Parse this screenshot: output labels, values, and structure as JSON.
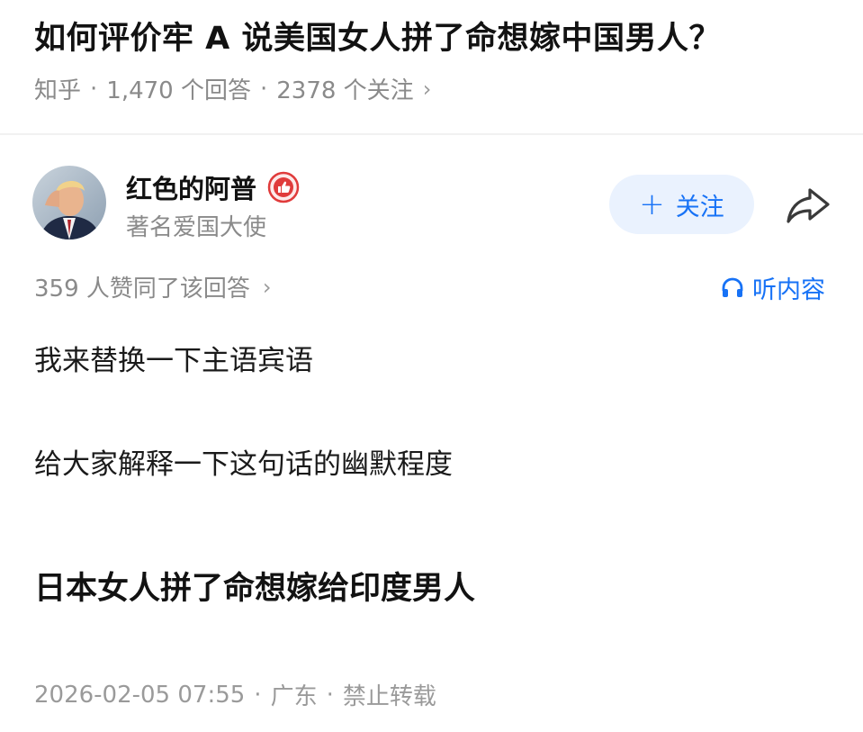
{
  "question": {
    "title": "如何评价牢 A 说美国女人拼了命想嫁中国男人？",
    "source": "知乎",
    "answers_count": "1,470 个回答",
    "followers_count": "2378 个关注",
    "separator": "·",
    "chevron": "›"
  },
  "author": {
    "name": "红色的阿普",
    "bio": "著名爱国大使",
    "badge_icon": "thumbs-up-badge-icon",
    "avatar_icon": "avatar-photo"
  },
  "actions": {
    "follow_plus": "+",
    "follow_label": "关注",
    "share_icon": "share-arrow-icon",
    "listen_icon": "headphones-icon",
    "listen_label": "听内容"
  },
  "answer": {
    "likes": "359 人赞同了该回答",
    "chevron": "›",
    "paragraphs": [
      "我来替换一下主语宾语",
      "给大家解释一下这句话的幽默程度",
      "日本女人拼了命想嫁给印度男人"
    ]
  },
  "footer": {
    "date": "2026-02-05 07:55",
    "location": "广东",
    "copyright": "禁止转载",
    "separator": "·"
  },
  "colors": {
    "accent": "#1772f6",
    "follow_bg": "#eaf2fe",
    "muted": "#8a8a8a",
    "badge": "#e03b3b"
  }
}
